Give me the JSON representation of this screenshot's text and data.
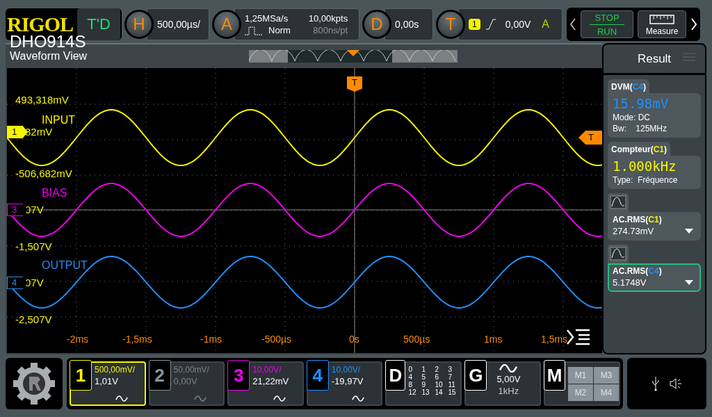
{
  "brand": {
    "logo": "RIGOL",
    "model": "DHO914S"
  },
  "mode": {
    "label": "T'D"
  },
  "horizontal": {
    "key": "H",
    "value": "500,00µs/"
  },
  "acquire": {
    "key": "A",
    "sample_rate": "1,25MSa/s",
    "memory": "10,00kpts",
    "mode": "Norm",
    "resolution": "800ns/pt"
  },
  "delay": {
    "key": "D",
    "value": "0,00s"
  },
  "trigger": {
    "key": "T",
    "source": "1",
    "level": "0,00V",
    "sweep": "A"
  },
  "run_control": {
    "stop": "STOP",
    "run": "RUN"
  },
  "measure_button": {
    "label": "Measure"
  },
  "waveform_view": {
    "title": "Waveform View",
    "trigger_marker": "T",
    "trigger_level_marker": "T",
    "channels": [
      {
        "name": "INPUT",
        "marker": "1",
        "selected": true,
        "color": "#f5f500",
        "top": "493,318mV",
        "offset": "82mV",
        "bottom": "-506,682mV"
      },
      {
        "name": "BIAS",
        "marker": "3",
        "selected": false,
        "color": "#f000f0",
        "offset": "07V",
        "bottom": "-1,507V"
      },
      {
        "name": "OUTPUT",
        "marker": "4",
        "selected": false,
        "color": "#1e90ff",
        "offset": "07V",
        "bottom": "-2,507V"
      }
    ],
    "time_labels": [
      "-2ms",
      "-1,5ms",
      "-1ms",
      "-500µs",
      "0s",
      "500µs",
      "1ms",
      "1,5ms"
    ]
  },
  "result": {
    "title": "Result",
    "cards": [
      {
        "kind": "dvm",
        "prefix": "DVM(",
        "source": "C4",
        "suffix": ")",
        "color": "#1e90ff",
        "reading": "15.98mV",
        "lines": [
          "Mode: DC",
          "Bw:    125MHz"
        ]
      },
      {
        "kind": "counter",
        "prefix": "Compteur(",
        "source": "C1",
        "suffix": ")",
        "color": "#f5f500",
        "reading": "1.000kHz",
        "lines": [
          "Type:  Fréquence"
        ]
      },
      {
        "kind": "measure",
        "prefix": "AC.RMS(",
        "source": "C1",
        "suffix": ")",
        "color": "#f5f500",
        "value": "274.73mV",
        "selected": false
      },
      {
        "kind": "measure",
        "prefix": "AC.RMS(",
        "source": "C4",
        "suffix": ")",
        "color": "#1e90ff",
        "value": "5.1748V",
        "selected": true
      }
    ]
  },
  "channel_cards": [
    {
      "number": "1",
      "scale": "500,00mV/",
      "offset": "1,01V",
      "enabled": true,
      "selected": true,
      "color": "#f5f500"
    },
    {
      "number": "2",
      "scale": "50,00mV/",
      "offset": "0,00V",
      "enabled": false,
      "selected": false,
      "color": "#8a949a"
    },
    {
      "number": "3",
      "scale": "10,00V/",
      "offset": "21,22mV",
      "enabled": true,
      "selected": false,
      "color": "#f000f0"
    },
    {
      "number": "4",
      "scale": "10,00V/",
      "offset": "-19,97V",
      "enabled": true,
      "selected": false,
      "color": "#1e90ff"
    }
  ],
  "digital": {
    "key": "D",
    "bits": [
      "0",
      "1",
      "2",
      "3",
      "4",
      "5",
      "6",
      "7",
      "8",
      "9",
      "10",
      "11",
      "12",
      "13",
      "14",
      "15"
    ]
  },
  "generator": {
    "key": "G",
    "amplitude": "5,00V",
    "frequency": "1kHz"
  },
  "math": {
    "key": "M",
    "slots": [
      "M1",
      "M3",
      "M2",
      "M4"
    ]
  }
}
